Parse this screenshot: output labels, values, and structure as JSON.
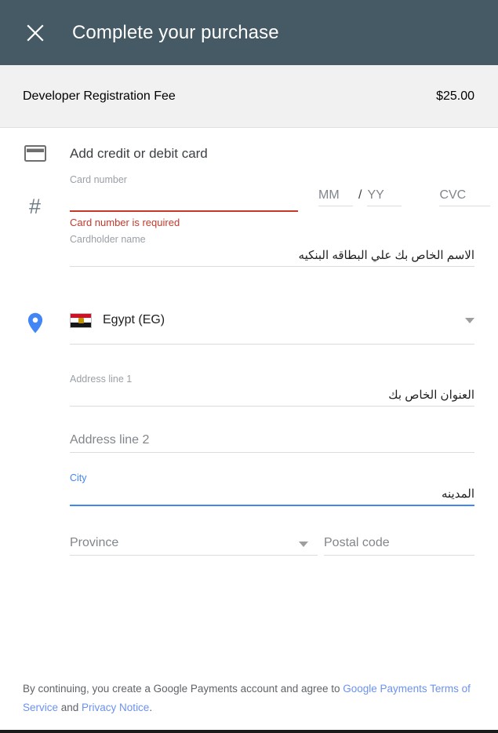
{
  "header": {
    "close_icon": "close-icon",
    "title": "Complete your purchase",
    "bg_color": "#455a64"
  },
  "fee": {
    "label": "Developer Registration Fee",
    "amount": "$25.00"
  },
  "card_section": {
    "icon": "credit-card-icon",
    "title": "Add credit or debit card",
    "number_icon": "#",
    "card_number": {
      "label": "Card number",
      "value": "",
      "error": "Card number is required",
      "error_color": "#c5392b"
    },
    "expiry_month": {
      "placeholder": "MM"
    },
    "separator": "/",
    "expiry_year": {
      "placeholder": "YY"
    },
    "cvc": {
      "placeholder": "CVC"
    },
    "cardholder_name": {
      "label": "Cardholder name",
      "value": "الاسم الخاص بك علي البطاقه البنكيه"
    }
  },
  "address_section": {
    "icon": "location-pin-icon",
    "country": {
      "flag": "egypt-flag-icon",
      "name": "Egypt (EG)",
      "caret": "chevron-down-icon"
    },
    "address_line_1": {
      "label": "Address line 1",
      "value": "العنوان الخاص بك"
    },
    "address_line_2": {
      "placeholder": "Address line 2",
      "value": ""
    },
    "city": {
      "label": "City",
      "value": "المدينه",
      "focused": true,
      "focus_color": "#4285f4"
    },
    "province": {
      "placeholder": "Province",
      "caret": "chevron-down-icon"
    },
    "postal_code": {
      "placeholder": "Postal code"
    }
  },
  "footer": {
    "text_before": "By continuing, you create a Google Payments account and agree to ",
    "link_terms": "Google Payments Terms of Service",
    "text_middle": " and ",
    "link_privacy": "Privacy Notice",
    "text_end": ".",
    "link_color": "#6b92f0"
  }
}
